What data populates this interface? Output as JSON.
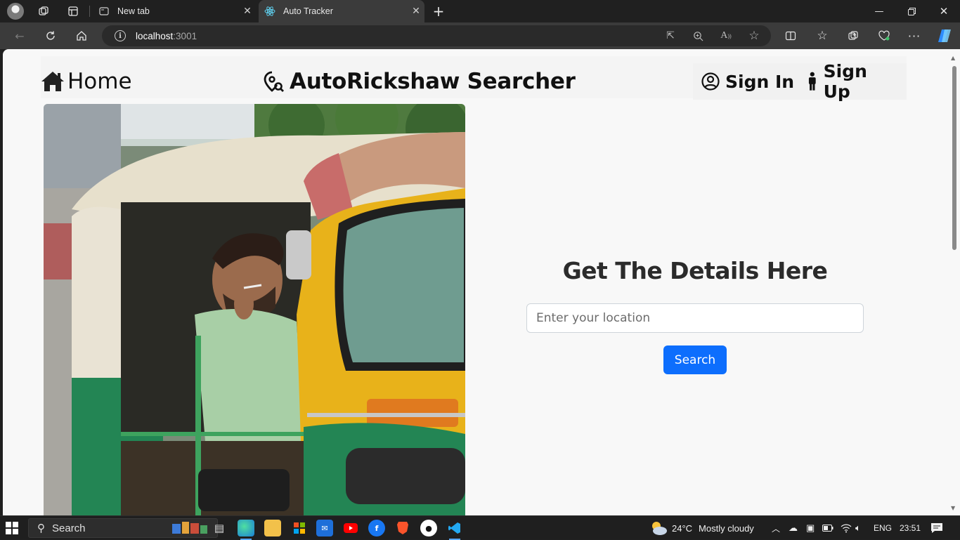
{
  "browser": {
    "tabs": [
      {
        "title": "New tab",
        "active": false
      },
      {
        "title": "Auto Tracker",
        "active": true
      }
    ],
    "url_host": "localhost",
    "url_port": ":3001"
  },
  "site": {
    "nav": {
      "home_label": "Home",
      "brand": "AutoRickshaw Searcher",
      "signin_label": "Sign In",
      "signup_label": "Sign Up"
    },
    "details": {
      "heading": "Get The Details Here",
      "location_placeholder": "Enter your location",
      "search_label": "Search"
    },
    "colors": {
      "primary": "#0d6efd",
      "page_bg": "#f8f8f8"
    }
  },
  "taskbar": {
    "search_label": "Search",
    "weather_temp": "24°C",
    "weather_text": "Mostly cloudy",
    "language": "ENG",
    "time": "23:51"
  }
}
